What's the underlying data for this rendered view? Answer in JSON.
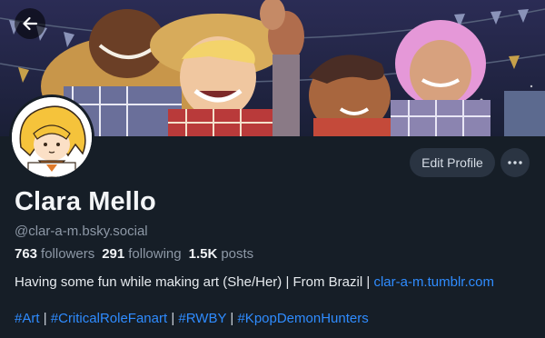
{
  "header": {
    "back_icon": "arrow-left-icon"
  },
  "profile": {
    "display_name": "Clara Mello",
    "handle": "@clar-a-m.bsky.social",
    "avatar_icon": "avatar-illustration",
    "stats": {
      "followers_count": "763",
      "followers_label": "followers",
      "following_count": "291",
      "following_label": "following",
      "posts_count": "1.5K",
      "posts_label": "posts"
    },
    "bio_text": "Having some fun while making art (She/Her) | From Brazil |",
    "bio_link": "clar-a-m.tumblr.com",
    "hashtags": [
      "#Art",
      "#CriticalRoleFanart",
      "#RWBY",
      "#KpopDemonHunters"
    ]
  },
  "actions": {
    "edit_profile_label": "Edit Profile",
    "more_icon": "more-horizontal-icon"
  },
  "colors": {
    "background": "#161e27",
    "link": "#2f8cff",
    "muted_text": "#8d98a6",
    "button_bg": "#2a3442"
  }
}
